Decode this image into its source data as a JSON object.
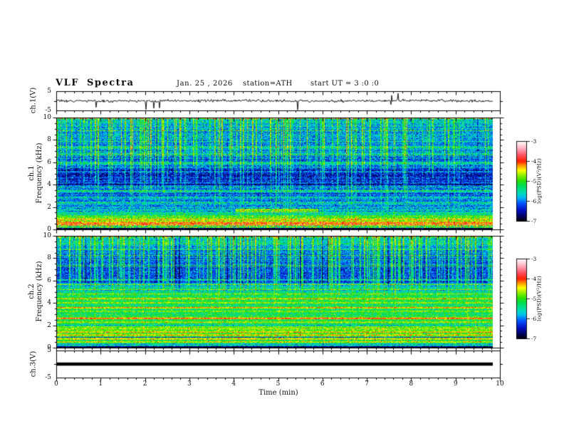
{
  "title": {
    "main": "VLF Spectra",
    "date": "Jan. 25 , 2026",
    "station": "station=ATH",
    "start_ut": "start UT =  3 :0 :0"
  },
  "panels": {
    "ch1_wave": "ch.1(V)",
    "ch1_spec_line1": "ch.1",
    "ch1_spec_line2": "Frequency (kHz)",
    "ch2_spec_line1": "ch.2",
    "ch2_spec_line2": "Frequency (kHz)",
    "ch3_wave": "ch.3(V)"
  },
  "axes": {
    "time_label": "Time (min)",
    "time_ticks": [
      0,
      1,
      2,
      3,
      4,
      5,
      6,
      7,
      8,
      9,
      10
    ],
    "time_range_min": [
      0,
      10
    ],
    "freq_ticks": [
      0,
      2,
      4,
      6,
      8,
      10
    ],
    "freq_range_khz": [
      0,
      10
    ],
    "volt_ticks": [
      5,
      -5
    ],
    "volt_range_v": [
      -5,
      5
    ],
    "colorbar_ticks": [
      -3,
      -4,
      -5,
      -6,
      -7
    ],
    "colorbar_range": [
      -7,
      -3
    ],
    "colorbar_label": "log(PSD)(V²/Hz)"
  },
  "palette": {
    "stops": [
      [
        -7.0,
        "#000000"
      ],
      [
        -6.8,
        "#000050"
      ],
      [
        -6.45,
        "#0010c0"
      ],
      [
        -6.1,
        "#0055ff"
      ],
      [
        -5.8,
        "#00c0f0"
      ],
      [
        -5.55,
        "#00e0b0"
      ],
      [
        -5.2,
        "#00dd50"
      ],
      [
        -4.95,
        "#30e000"
      ],
      [
        -4.7,
        "#90f000"
      ],
      [
        -4.45,
        "#ffff00"
      ],
      [
        -4.2,
        "#ff9000"
      ],
      [
        -4.0,
        "#ff2000"
      ],
      [
        -3.7,
        "#ff5060"
      ],
      [
        -3.35,
        "#ffb0c0"
      ],
      [
        -3.0,
        "#ffffff"
      ]
    ]
  },
  "chart_data": [
    {
      "type": "line",
      "panel": "ch.1 time series",
      "ylabel": "ch.1(V)",
      "ylim": [
        -5,
        5
      ],
      "yticks": [
        5,
        -5
      ],
      "xlim_min": [
        0,
        10
      ],
      "data_end_min": 9.84,
      "baseline_v": 0,
      "typical_noise_v": 0.33,
      "description": "Noisy channel-1 voltage hovering near 0 V with frequent impulsive sferic spikes, mostly downward, up to about ±5 V"
    },
    {
      "type": "heatmap",
      "panel": "ch.1 spectrogram",
      "ylabel": "Frequency (kHz)",
      "ylim": [
        0,
        10
      ],
      "yticks": [
        0,
        2,
        4,
        6,
        8,
        10
      ],
      "xlim_min": [
        0,
        10
      ],
      "data_end_min": 9.84,
      "colorbar": {
        "label": "log(PSD)(V²/Hz)",
        "ticks": [
          -3,
          -4,
          -5,
          -6,
          -7
        ],
        "range": [
          -7,
          -3
        ]
      },
      "profile": [
        [
          10,
          -5.2
        ],
        [
          9.8,
          -5.75
        ],
        [
          9,
          -5.85
        ],
        [
          8,
          -5.9
        ],
        [
          7,
          -6.0
        ],
        [
          6.3,
          -6.1
        ],
        [
          5.8,
          -6.05
        ],
        [
          5.3,
          -6.3
        ],
        [
          4.5,
          -6.35
        ],
        [
          4.1,
          -6.15
        ],
        [
          3.2,
          -6.0
        ],
        [
          2.4,
          -5.9
        ],
        [
          1.7,
          -5.75
        ],
        [
          1.4,
          -5.45
        ],
        [
          1.25,
          -5.0
        ],
        [
          1.0,
          -4.8
        ],
        [
          0.75,
          -4.65
        ],
        [
          0.5,
          -4.5
        ],
        [
          0.3,
          -4.6
        ],
        [
          0.17,
          -5.0
        ],
        [
          0.13,
          -7
        ],
        [
          0,
          -7
        ]
      ],
      "bands": [
        {
          "f": 7.35,
          "w": 0.08,
          "a": 0.55
        },
        {
          "f": 6.8,
          "w": 0.06,
          "a": 0.4
        },
        {
          "f": 5.95,
          "w": 0.09,
          "a": 0.65
        },
        {
          "f": 5.55,
          "w": 0.05,
          "a": 0.35
        },
        {
          "f": 5.15,
          "w": 0.06,
          "a": 0.5
        },
        {
          "f": 4.9,
          "w": 0.3,
          "a": -0.25
        },
        {
          "f": 4.65,
          "w": 0.05,
          "a": 0.4
        },
        {
          "f": 3.45,
          "w": 0.06,
          "a": 0.5
        },
        {
          "f": 2.9,
          "w": 0.05,
          "a": 0.4
        },
        {
          "f": 2.35,
          "w": 0.04,
          "a": 0.3
        },
        {
          "f": 1.8,
          "w": 0.04,
          "a": 0.3
        },
        {
          "f": 1.45,
          "w": 0.04,
          "a": 0.4
        },
        {
          "f": 0.95,
          "w": 0.04,
          "a": 0.45
        },
        {
          "f": 0.6,
          "w": 0.04,
          "a": 0.5
        },
        {
          "f": 0.3,
          "w": 0.03,
          "a": -0.6
        }
      ],
      "streaks": {
        "prob": 0.22,
        "min": 0.4,
        "max": 1.3,
        "neg_prob": 0.06,
        "neg_strength": 0.45,
        "full_above": 7.5,
        "fade_to": 2,
        "min_weight": 0.3,
        "carry": 0.35,
        "depth_max": 6
      },
      "row_noise": 0.12,
      "pixel_noise": 0.3,
      "speckle": {
        "f0": 0.15,
        "f1": 0.5,
        "sigma": 0.5
      },
      "top_row": {
        "above": 9.88,
        "level": -4.6,
        "sigma": 0.7
      },
      "patches": [
        {
          "f0": 1.55,
          "f1": 1.85,
          "t0": 4.1,
          "t1": 6.0,
          "a": 0.9
        }
      ],
      "description": "Mostly blue (≈1e-6 V²/Hz) background with dense vertical sferic streaks above ~7 kHz, cyan horizontal bands, dark band near 4.5-5.3 kHz, bright green/orange hum bands below 1.3 kHz, black at the very bottom"
    },
    {
      "type": "heatmap",
      "panel": "ch.2 spectrogram",
      "ylabel": "Frequency (kHz)",
      "ylim": [
        0,
        10
      ],
      "yticks": [
        0,
        2,
        4,
        6,
        8,
        10
      ],
      "xlim_min": [
        0,
        10
      ],
      "data_end_min": 9.84,
      "colorbar": {
        "label": "log(PSD)(V²/Hz)",
        "ticks": [
          -3,
          -4,
          -5,
          -6,
          -7
        ],
        "range": [
          -7,
          -3
        ]
      },
      "profile": [
        [
          10,
          -5.45
        ],
        [
          9.4,
          -5.65
        ],
        [
          8.8,
          -5.95
        ],
        [
          8,
          -6.1
        ],
        [
          7,
          -6.15
        ],
        [
          6.4,
          -6.25
        ],
        [
          5.9,
          -6.15
        ],
        [
          5.6,
          -5.8
        ],
        [
          5.2,
          -5.45
        ],
        [
          4.7,
          -5.2
        ],
        [
          4.2,
          -5.25
        ],
        [
          3.5,
          -5.25
        ],
        [
          2.8,
          -5.15
        ],
        [
          2.0,
          -5.05
        ],
        [
          1.4,
          -5.0
        ],
        [
          0.9,
          -5.0
        ],
        [
          0.5,
          -5.05
        ],
        [
          0.25,
          -5.3
        ],
        [
          0.14,
          -6.2
        ],
        [
          0.1,
          -7
        ],
        [
          0,
          -7
        ]
      ],
      "bands": [
        {
          "f": 6.1,
          "w": 0.06,
          "a": 0.5
        },
        {
          "f": 5.7,
          "w": 0.05,
          "a": 0.4
        },
        {
          "f": 4.4,
          "w": 0.07,
          "a": 0.75
        },
        {
          "f": 4.05,
          "w": 0.05,
          "a": 0.55
        },
        {
          "f": 3.62,
          "w": 0.05,
          "a": 1.05
        },
        {
          "f": 3.3,
          "w": 0.05,
          "a": 0.55
        },
        {
          "f": 2.65,
          "w": 0.05,
          "a": 1.15
        },
        {
          "f": 2.3,
          "w": 0.04,
          "a": 0.6
        },
        {
          "f": 2.05,
          "w": 0.03,
          "a": -0.7
        },
        {
          "f": 1.75,
          "w": 0.04,
          "a": 0.65
        },
        {
          "f": 1.45,
          "w": 0.04,
          "a": 0.5
        },
        {
          "f": 1.15,
          "w": 0.035,
          "a": 0.8
        },
        {
          "f": 0.95,
          "w": 0.025,
          "a": -1.3
        },
        {
          "f": 0.78,
          "w": 0.035,
          "a": 0.9
        },
        {
          "f": 0.55,
          "w": 0.03,
          "a": 0.5
        },
        {
          "f": 0.35,
          "w": 0.025,
          "a": -1.0
        }
      ],
      "streaks": {
        "prob": 0.3,
        "min": 0.5,
        "max": 1.2,
        "neg_prob": 0.1,
        "neg_strength": 0.5,
        "full_above": 6.3,
        "fade_to": 4.5,
        "min_weight": 0.13,
        "carry": 0.4,
        "depth_max": 6
      },
      "row_noise": 0.12,
      "pixel_noise": 0.27,
      "top_row": {
        "above": 9.88,
        "level": -4.8,
        "sigma": 0.6
      },
      "patches": [],
      "description": "Blue streaky region above ~6 kHz with strong vertical sferics; green/cyan background (≈1e-5 V²/Hz) below ~5.5 kHz crossed by yellow-orange and red hum lines and thin black lines near 0.95 and 0.35 kHz; black bottom edge"
    },
    {
      "type": "line",
      "panel": "ch.3 time series",
      "ylabel": "ch.3(V)",
      "ylim": [
        -5,
        5
      ],
      "yticks": [
        5,
        -5
      ],
      "xlim_min": [
        0,
        10
      ],
      "data_end_min": 9.84,
      "value_v": 0,
      "description": "Flat (inactive) channel: constant thick black line at 0 V"
    }
  ]
}
